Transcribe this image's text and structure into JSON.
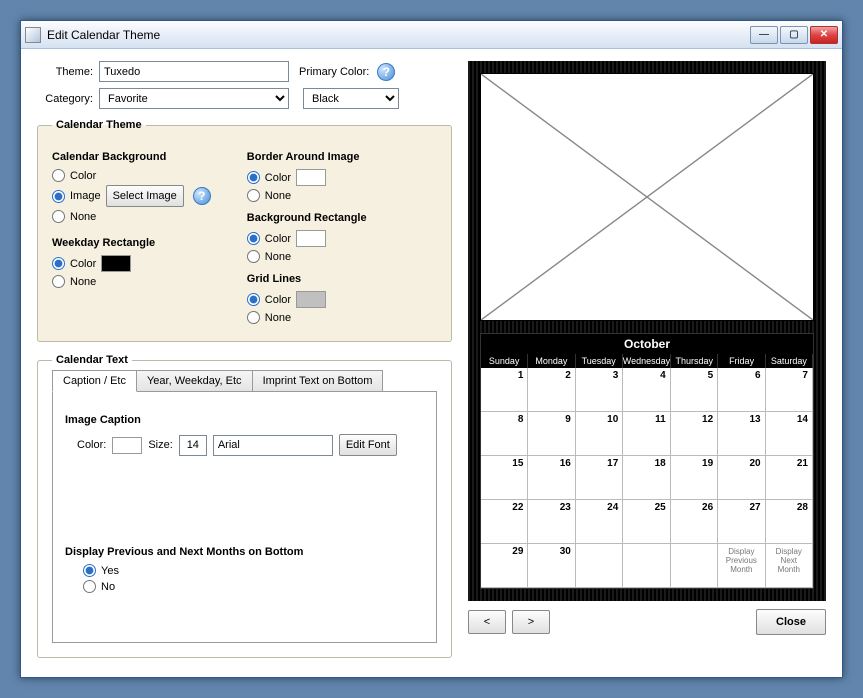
{
  "window": {
    "title": "Edit Calendar Theme"
  },
  "form": {
    "theme_label": "Theme:",
    "theme_value": "Tuxedo",
    "category_label": "Category:",
    "category_value": "Favorite",
    "primary_color_label": "Primary Color:",
    "primary_color_value": "Black"
  },
  "calendar_theme": {
    "legend": "Calendar Theme",
    "bg": {
      "title": "Calendar Background",
      "color": "Color",
      "image": "Image",
      "none": "None",
      "select_image": "Select Image"
    },
    "weekday": {
      "title": "Weekday Rectangle",
      "color": "Color",
      "none": "None",
      "swatch": "#000000"
    },
    "border": {
      "title": "Border Around Image",
      "color": "Color",
      "none": "None",
      "swatch": "#ffffff"
    },
    "bgrect": {
      "title": "Background Rectangle",
      "color": "Color",
      "none": "None",
      "swatch": "#ffffff"
    },
    "grid": {
      "title": "Grid Lines",
      "color": "Color",
      "none": "None",
      "swatch": "#c0c0c0"
    }
  },
  "calendar_text": {
    "legend": "Calendar Text",
    "tabs": {
      "caption": "Caption / Etc",
      "year": "Year, Weekday, Etc",
      "imprint": "Imprint Text on Bottom"
    },
    "image_caption": {
      "title": "Image Caption",
      "color_label": "Color:",
      "size_label": "Size:",
      "size_value": "14",
      "font_value": "Arial",
      "edit_font": "Edit Font"
    },
    "display_prev_next": {
      "title": "Display Previous and Next Months on Bottom",
      "yes": "Yes",
      "no": "No"
    }
  },
  "preview": {
    "month": "October",
    "weekdays": [
      "Sunday",
      "Monday",
      "Tuesday",
      "Wednesday",
      "Thursday",
      "Friday",
      "Saturday"
    ],
    "days": [
      "1",
      "2",
      "3",
      "4",
      "5",
      "6",
      "7",
      "8",
      "9",
      "10",
      "11",
      "12",
      "13",
      "14",
      "15",
      "16",
      "17",
      "18",
      "19",
      "20",
      "21",
      "22",
      "23",
      "24",
      "25",
      "26",
      "27",
      "28",
      "29",
      "30",
      "",
      "",
      "",
      "Display\nPrevious\nMonth",
      "Display\nNext\nMonth"
    ]
  },
  "nav": {
    "prev": "<",
    "next": ">",
    "close": "Close"
  }
}
